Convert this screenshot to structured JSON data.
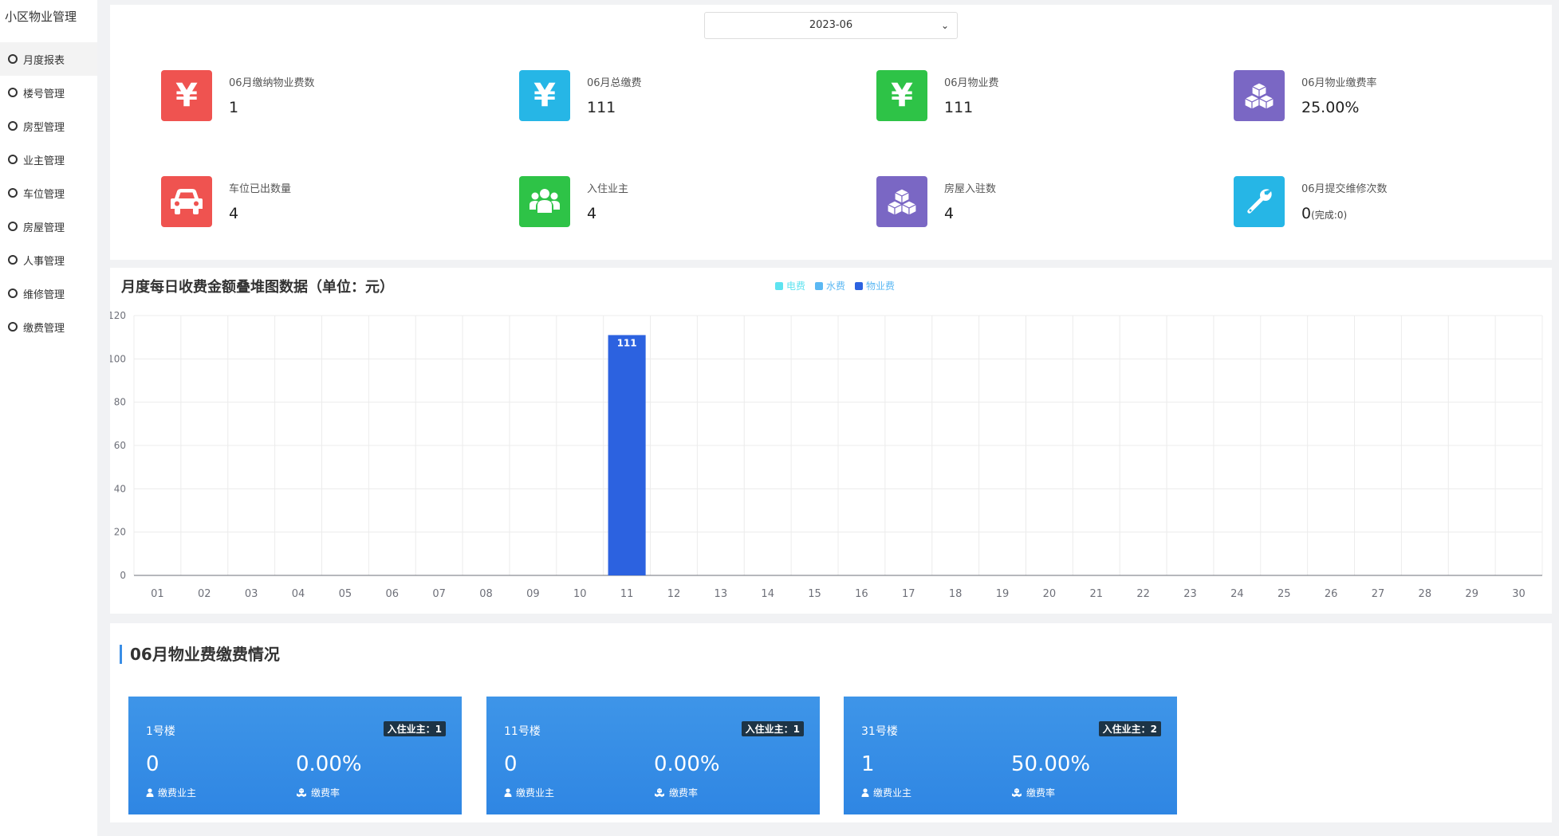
{
  "app_title": "小区物业管理",
  "nav": [
    {
      "label": "月度报表",
      "active": true
    },
    {
      "label": "楼号管理"
    },
    {
      "label": "房型管理"
    },
    {
      "label": "业主管理"
    },
    {
      "label": "车位管理"
    },
    {
      "label": "房屋管理"
    },
    {
      "label": "人事管理"
    },
    {
      "label": "维修管理"
    },
    {
      "label": "缴费管理"
    }
  ],
  "month_select": {
    "value": "2023-06"
  },
  "stats": [
    {
      "label": "06月缴纳物业费数",
      "value": "1",
      "icon": "yen-icon",
      "color": "#ef5350"
    },
    {
      "label": "06月总缴费",
      "value": "111",
      "icon": "yen-icon",
      "color": "#26b6e6"
    },
    {
      "label": "06月物业费",
      "value": "111",
      "icon": "yen-icon",
      "color": "#2ec347"
    },
    {
      "label": "06月物业缴费率",
      "value": "25.00%",
      "icon": "cubes-icon",
      "color": "#7a67c4"
    },
    {
      "label": "车位已出数量",
      "value": "4",
      "icon": "car-icon",
      "color": "#ef5350"
    },
    {
      "label": "入住业主",
      "value": "4",
      "icon": "users-icon",
      "color": "#2ec347"
    },
    {
      "label": "房屋入驻数",
      "value": "4",
      "icon": "cubes-icon",
      "color": "#7a67c4"
    },
    {
      "label": "06月提交维修次数",
      "value": "0",
      "sub": "(完成:0)",
      "icon": "wrench-icon",
      "color": "#26b6e6"
    }
  ],
  "chart_data": {
    "type": "bar",
    "title": "月度每日收费金额叠堆图数据（单位：元）",
    "stacked": true,
    "categories": [
      "01",
      "02",
      "03",
      "04",
      "05",
      "06",
      "07",
      "08",
      "09",
      "10",
      "11",
      "12",
      "13",
      "14",
      "15",
      "16",
      "17",
      "18",
      "19",
      "20",
      "21",
      "22",
      "23",
      "24",
      "25",
      "26",
      "27",
      "28",
      "29",
      "30"
    ],
    "series": [
      {
        "name": "电费",
        "color": "#5ee3f0",
        "values": [
          0,
          0,
          0,
          0,
          0,
          0,
          0,
          0,
          0,
          0,
          0,
          0,
          0,
          0,
          0,
          0,
          0,
          0,
          0,
          0,
          0,
          0,
          0,
          0,
          0,
          0,
          0,
          0,
          0,
          0
        ]
      },
      {
        "name": "水费",
        "color": "#5bb8f3",
        "values": [
          0,
          0,
          0,
          0,
          0,
          0,
          0,
          0,
          0,
          0,
          0,
          0,
          0,
          0,
          0,
          0,
          0,
          0,
          0,
          0,
          0,
          0,
          0,
          0,
          0,
          0,
          0,
          0,
          0,
          0
        ]
      },
      {
        "name": "物业费",
        "color": "#2c62e0",
        "values": [
          0,
          0,
          0,
          0,
          0,
          0,
          0,
          0,
          0,
          0,
          111,
          0,
          0,
          0,
          0,
          0,
          0,
          0,
          0,
          0,
          0,
          0,
          0,
          0,
          0,
          0,
          0,
          0,
          0,
          0
        ]
      }
    ],
    "ylim": [
      0,
      120
    ],
    "yticks": [
      "0",
      "20",
      "40",
      "60",
      "80",
      "100",
      "120"
    ],
    "bar_labels": [
      {
        "category": "11",
        "text": "111"
      }
    ],
    "grid": true,
    "legend": "top-center"
  },
  "bottom": {
    "title": "06月物业费缴费情况",
    "cards": [
      {
        "name": "1号楼",
        "badge": "入住业主：1",
        "paid": "0",
        "rate": "0.00%",
        "paid_label": "缴费业主",
        "rate_label": "缴费率"
      },
      {
        "name": "11号楼",
        "badge": "入住业主：1",
        "paid": "0",
        "rate": "0.00%",
        "paid_label": "缴费业主",
        "rate_label": "缴费率"
      },
      {
        "name": "31号楼",
        "badge": "入住业主：2",
        "paid": "1",
        "rate": "50.00%",
        "paid_label": "缴费业主",
        "rate_label": "缴费率"
      }
    ]
  }
}
